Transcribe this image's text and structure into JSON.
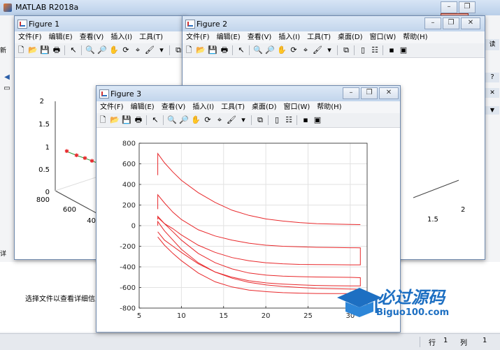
{
  "matlab": {
    "title": "MATLAB R2018a",
    "details_text": "选择文件以查看详细信息"
  },
  "status": {
    "row_label": "行",
    "row_value": "1",
    "col_label": "列",
    "col_value": "1"
  },
  "menu": [
    "文件(F)",
    "编辑(E)",
    "查看(V)",
    "插入(I)",
    "工具(T)",
    "桌面(D)",
    "窗口(W)",
    "帮助(H)"
  ],
  "figures": {
    "f1": "Figure 1",
    "f2": "Figure 2",
    "f3": "Figure 3"
  },
  "watermark": {
    "title": "必过源码",
    "url": "Biguo100.com"
  },
  "fig1_axes": {
    "z_ticks": [
      "2",
      "1.5",
      "1",
      "0.5",
      "0"
    ],
    "x_ticks": [
      "800",
      "600",
      "40"
    ]
  },
  "fig2_axes": {
    "ticks": [
      "2",
      "1.5"
    ]
  },
  "colors": {
    "curve": "#e8282b",
    "title_bar": "#c2d5ec"
  },
  "chart_data": {
    "type": "line",
    "xlim": [
      5,
      32
    ],
    "ylim": [
      -800,
      800
    ],
    "x_ticks": [
      5,
      10,
      15,
      20,
      25,
      30
    ],
    "y_ticks": [
      800,
      600,
      400,
      200,
      0,
      -200,
      -400,
      -600,
      -800
    ],
    "grid": true,
    "series": [
      {
        "x": [
          7.2,
          7.2,
          8,
          9,
          10,
          12,
          14,
          16,
          18,
          20,
          22,
          24,
          26,
          28,
          30,
          31.2
        ],
        "y": [
          490,
          700,
          610,
          520,
          440,
          320,
          225,
          150,
          100,
          65,
          45,
          30,
          20,
          15,
          12,
          10
        ]
      },
      {
        "x": [
          7.2,
          7.2,
          8,
          9,
          10,
          12,
          14,
          16,
          18,
          20,
          22,
          24,
          26,
          28,
          30,
          31.2,
          31.2,
          30,
          28,
          26,
          24,
          22,
          20,
          18,
          16,
          14,
          12,
          10,
          9,
          8,
          7.2
        ],
        "y": [
          160,
          300,
          220,
          130,
          60,
          -40,
          -100,
          -140,
          -170,
          -190,
          -200,
          -205,
          -210,
          -212,
          -214,
          -215,
          -380,
          -380,
          -379,
          -378,
          -376,
          -370,
          -360,
          -340,
          -310,
          -260,
          -190,
          -90,
          -30,
          20,
          80
        ]
      },
      {
        "x": [
          7.2,
          7.2,
          8,
          9,
          10,
          12,
          14,
          16,
          18,
          20,
          22,
          24,
          26,
          28,
          30,
          31.2,
          31.2,
          30,
          28,
          26,
          24,
          22,
          20,
          18,
          16,
          14,
          12,
          10,
          9,
          8,
          7.2
        ],
        "y": [
          60,
          90,
          20,
          -60,
          -140,
          -270,
          -360,
          -420,
          -460,
          -480,
          -490,
          -495,
          -498,
          -500,
          -502,
          -505,
          -585,
          -585,
          -583,
          -580,
          -575,
          -567,
          -555,
          -535,
          -500,
          -450,
          -370,
          -260,
          -200,
          -140,
          -60
        ]
      },
      {
        "x": [
          7.2,
          7.2,
          8,
          9,
          10,
          12,
          14,
          16,
          18,
          20,
          22,
          24,
          26,
          28,
          30,
          31.2,
          31.2,
          30,
          28,
          26,
          24,
          22,
          20,
          18,
          16,
          14,
          12,
          10,
          9,
          8,
          7.2
        ],
        "y": [
          0,
          40,
          -50,
          -140,
          -230,
          -360,
          -450,
          -510,
          -550,
          -575,
          -590,
          -600,
          -608,
          -612,
          -615,
          -617,
          -660,
          -660,
          -660,
          -658,
          -655,
          -650,
          -640,
          -625,
          -595,
          -545,
          -460,
          -340,
          -270,
          -190,
          -110
        ]
      }
    ]
  }
}
